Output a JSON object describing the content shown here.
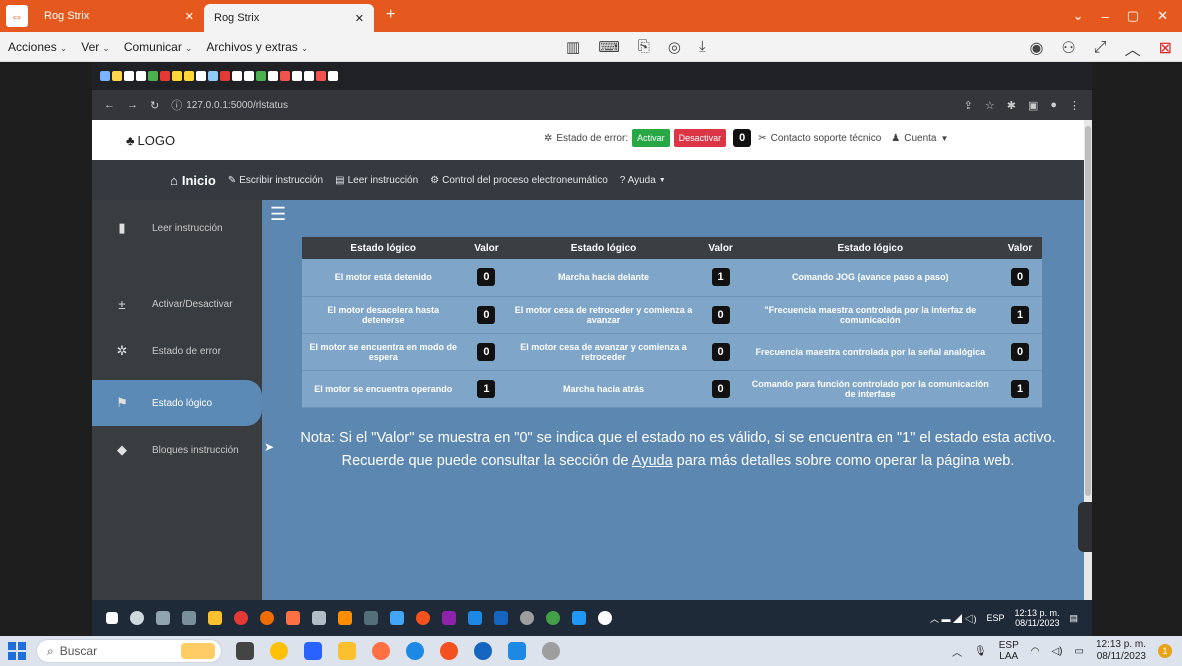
{
  "viewer": {
    "tabs": [
      {
        "label": "Rog Strix",
        "active": false
      },
      {
        "label": "Rog Strix",
        "active": true
      }
    ],
    "menus": [
      "Acciones",
      "Ver",
      "Comunicar",
      "Archivos y extras"
    ]
  },
  "browser": {
    "url": "127.0.0.1:5000/rlstatus"
  },
  "site": {
    "logo": "LOGO",
    "error_label": "Estado de error:",
    "activate_label": "Activar",
    "deactivate_label": "Desactivar",
    "error_count": "0",
    "support_label": "Contacto soporte técnico",
    "account_label": "Cuenta"
  },
  "nav": {
    "home": "Inicio",
    "items": [
      "Escribir instrucción",
      "Leer instrucción",
      "Control del proceso electroneumático",
      "? Ayuda"
    ]
  },
  "sidebar": {
    "items": [
      {
        "label": "Leer instrucción",
        "icon": "file-icon",
        "active": false
      },
      {
        "label": "Activar/Desactivar",
        "icon": "plus-minus-icon",
        "active": false
      },
      {
        "label": "Estado de error",
        "icon": "bug-icon",
        "active": false
      },
      {
        "label": "Estado lógico",
        "icon": "flag-icon",
        "active": true
      },
      {
        "label": "Bloques instrucción",
        "icon": "cube-icon",
        "active": false
      }
    ]
  },
  "table": {
    "headers": [
      "Estado lógico",
      "Valor",
      "Estado lógico",
      "Valor",
      "Estado lógico",
      "Valor"
    ],
    "rows": [
      [
        {
          "label": "El motor está detenido",
          "value": "0"
        },
        {
          "label": "Marcha hacia delante",
          "value": "1"
        },
        {
          "label": "Comando JOG (avance paso a paso)",
          "value": "0"
        }
      ],
      [
        {
          "label": "El motor desacelera hasta detenerse",
          "value": "0"
        },
        {
          "label": "El motor cesa de retroceder y comienza a avanzar",
          "value": "0"
        },
        {
          "label": "\"Frecuencia maestra controlada por la interfaz de comunicación",
          "value": "1"
        }
      ],
      [
        {
          "label": "El motor se encuentra en modo de espera",
          "value": "0"
        },
        {
          "label": "El motor cesa de avanzar y comienza a retroceder",
          "value": "0"
        },
        {
          "label": "Frecuencia maestra controlada por la señal analógica",
          "value": "0"
        }
      ],
      [
        {
          "label": "El motor se encuentra operando",
          "value": "1"
        },
        {
          "label": "Marcha hacia atrás",
          "value": "0"
        },
        {
          "label": "Comando para función controlado por la comunicación de interfase",
          "value": "1"
        }
      ]
    ]
  },
  "note": {
    "prefix": "Nota: Si el \"Valor\" se muestra en \"0\" se indica que el estado no es válido, si se encuentra en \"1\" el estado esta activo. Recuerde que puede consultar la sección de ",
    "link": "Ayuda",
    "suffix": " para más detalles sobre como operar la página web."
  },
  "remote_taskbar": {
    "lang": "ESP",
    "time": "12:13 p. m.",
    "date": "08/11/2023"
  },
  "taskbar": {
    "search_placeholder": "Buscar",
    "lang": "ESP",
    "lang_sub": "LAA",
    "time": "12:13 p. m.",
    "date": "08/11/2023",
    "notif_count": "1"
  },
  "colors": {
    "viewer_accent": "#e5591e",
    "content_bg": "#5b87b0",
    "table_cell": "#7fa6c9",
    "navbar": "#343a40",
    "sidebar": "#3a3d40",
    "active_side": "#5a8ab5"
  }
}
